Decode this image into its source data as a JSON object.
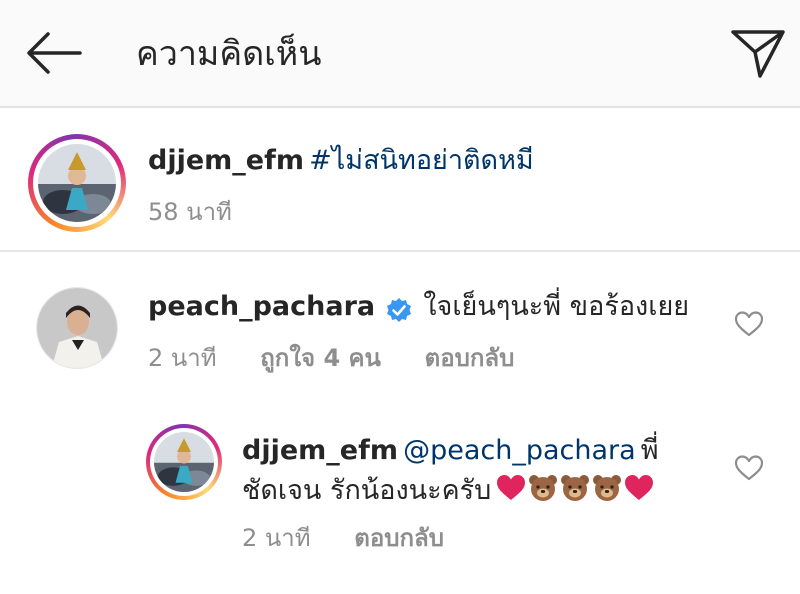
{
  "header": {
    "title": "ความคิดเห็น",
    "back_icon": "arrow-left-icon",
    "send_icon": "paper-plane-icon"
  },
  "caption": {
    "username": "djjem_efm",
    "text": "#ไม่สนิทอย่าติดหมี",
    "time": "58 นาที"
  },
  "comments": [
    {
      "username": "peach_pachara",
      "verified": true,
      "text": "ใจเย็นๆนะพี่ ขอร้องเยย",
      "time": "2 นาที",
      "likes": "ถูกใจ 4 คน",
      "reply_label": "ตอบกลับ"
    },
    {
      "username": "djjem_efm",
      "mention": "@peach_pachara",
      "text_line1_tail": "พี่",
      "text_line2": "ชัดเจน รักน้องนะครับ",
      "emojis": [
        "red-heart",
        "bear-face",
        "bear-face",
        "bear-face",
        "red-heart"
      ],
      "time": "2 นาที",
      "reply_label": "ตอบกลับ"
    }
  ],
  "colors": {
    "link": "#003569",
    "meta": "#8e8e8e",
    "verified": "#3897f0",
    "heart_emoji": "#e0245e"
  }
}
